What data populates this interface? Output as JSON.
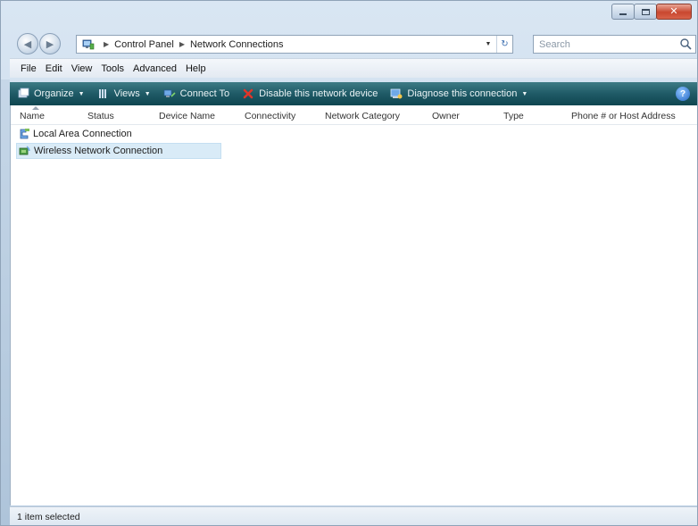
{
  "navigation": {
    "back_glyph": "◀",
    "forward_glyph": "▶"
  },
  "address": {
    "crumbs": [
      "Control Panel",
      "Network Connections"
    ],
    "search_placeholder": "Search"
  },
  "menu": [
    "File",
    "Edit",
    "View",
    "Tools",
    "Advanced",
    "Help"
  ],
  "toolbar": [
    {
      "label": "Organize",
      "icon": "organize-icon",
      "caret": true
    },
    {
      "label": "Views",
      "icon": "views-icon",
      "caret": true
    },
    {
      "label": "Connect To",
      "icon": "connect-to-icon",
      "caret": false
    },
    {
      "label": "Disable this network device",
      "icon": "disable-device-icon",
      "caret": false
    },
    {
      "label": "Diagnose this connection",
      "icon": "diagnose-icon",
      "caret": true
    }
  ],
  "columns": [
    "Name",
    "Status",
    "Device Name",
    "Connectivity",
    "Network Category",
    "Owner",
    "Type",
    "Phone # or Host Address"
  ],
  "items": [
    {
      "label": "Local Area Connection",
      "icon": "lan-connection-icon",
      "selected": false
    },
    {
      "label": "Wireless Network Connection",
      "icon": "wireless-connection-icon",
      "selected": true
    }
  ],
  "status": {
    "text": "1 item selected"
  },
  "colors": {
    "toolbar": "#1f5a66",
    "selection": "#d9ebf7",
    "close_button": "#c9472f"
  }
}
